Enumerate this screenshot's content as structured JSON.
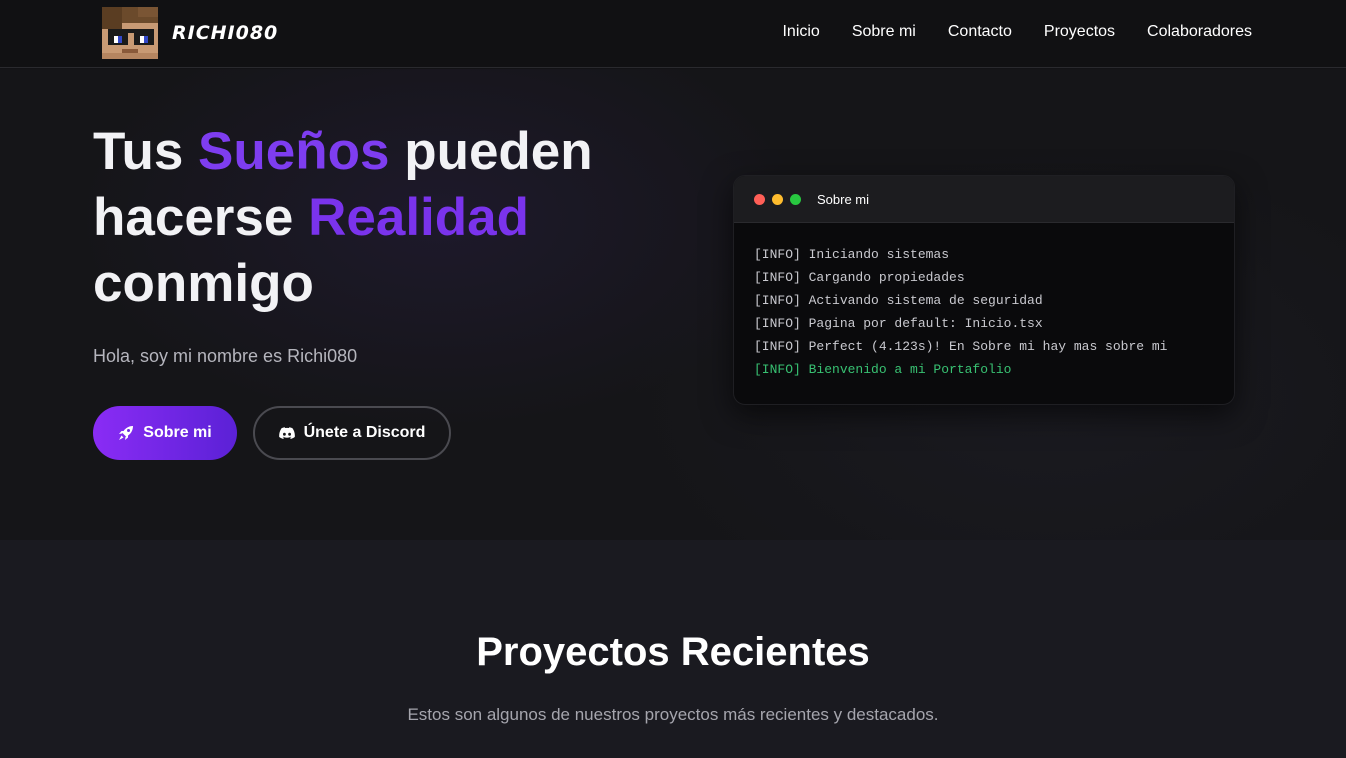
{
  "brand": {
    "name": "RICHI080",
    "avatar_icon": "minecraft-skin-avatar-icon"
  },
  "nav": {
    "items": [
      "Inicio",
      "Sobre mi",
      "Contacto",
      "Proyectos",
      "Colaboradores"
    ]
  },
  "hero": {
    "title_parts": [
      "Tus ",
      "Sueños",
      " pueden",
      "hacerse ",
      "Realidad",
      "conmigo"
    ],
    "subtitle": "Hola, soy mi nombre es Richi080",
    "primary_button": {
      "label": "Sobre mi",
      "icon": "rocket-icon"
    },
    "secondary_button": {
      "label": "Únete a Discord",
      "icon": "discord-icon"
    }
  },
  "terminal": {
    "title": "Sobre mi",
    "lines": [
      "[INFO] Iniciando sistemas",
      "[INFO] Cargando propiedades",
      "[INFO] Activando sistema de seguridad",
      "[INFO] Pagina por default: Inicio.tsx",
      "[INFO] Perfect (4.123s)! En Sobre mi hay mas sobre mi",
      "[INFO] Bienvenido a mi Portafolio"
    ],
    "dot_colors": [
      "#ff5f57",
      "#febc2e",
      "#28c840"
    ]
  },
  "projects": {
    "title": "Proyectos Recientes",
    "subtitle": "Estos son algunos de nuestros proyectos más recientes y destacados."
  },
  "colors": {
    "accent": "#7e3df0",
    "background": "#151518",
    "success": "#38c172"
  }
}
